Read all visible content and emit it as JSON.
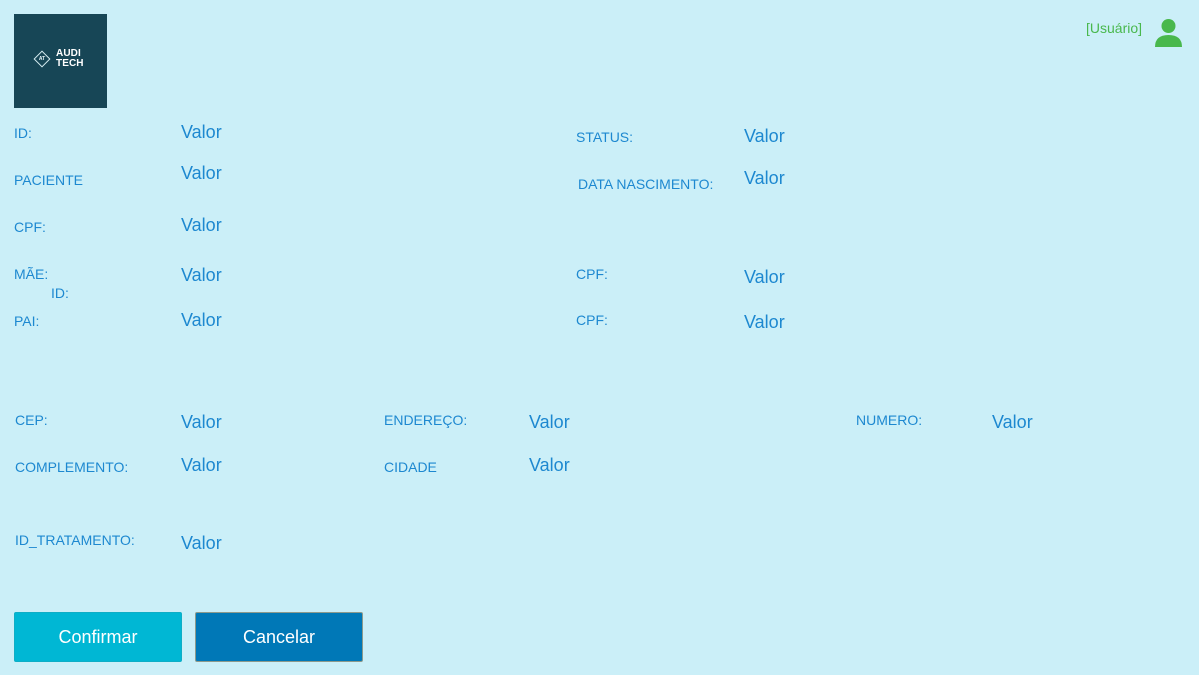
{
  "header": {
    "logo": {
      "monogram": "AT",
      "line1": "AUDI",
      "line2": "TECH"
    },
    "user_label": "[Usuário]",
    "user_icon": "user-icon"
  },
  "fields": {
    "id": {
      "label": "ID:",
      "value": "Valor"
    },
    "status": {
      "label": "STATUS:",
      "value": "Valor"
    },
    "paciente": {
      "label": "PACIENTE",
      "value": "Valor"
    },
    "data_nascimento": {
      "label": "DATA NASCIMENTO:",
      "value": "Valor"
    },
    "cpf": {
      "label": "CPF:",
      "value": "Valor"
    },
    "mae": {
      "label": "MÃE:",
      "sub_label": "ID:",
      "value": "Valor"
    },
    "mae_cpf": {
      "label": "CPF:",
      "value": "Valor"
    },
    "pai": {
      "label": "PAI:",
      "value": "Valor"
    },
    "pai_cpf": {
      "label": "CPF:",
      "value": "Valor"
    },
    "cep": {
      "label": "CEP:",
      "value": "Valor"
    },
    "endereco": {
      "label": "ENDEREÇO:",
      "value": "Valor"
    },
    "numero": {
      "label": "NUMERO:",
      "value": "Valor"
    },
    "complemento": {
      "label": "COMPLEMENTO:",
      "value": "Valor"
    },
    "cidade": {
      "label": "CIDADE",
      "value": "Valor"
    },
    "id_tratamento": {
      "label": "ID_TRATAMENTO:",
      "value": "Valor"
    }
  },
  "actions": {
    "confirm_label": "Confirmar",
    "cancel_label": "Cancelar"
  },
  "colors": {
    "background": "#cbeff8",
    "label": "#1d88d0",
    "user": "#49b84d",
    "confirm": "#00b7d4",
    "cancel": "#0078b7",
    "logo_bg": "#174656"
  }
}
